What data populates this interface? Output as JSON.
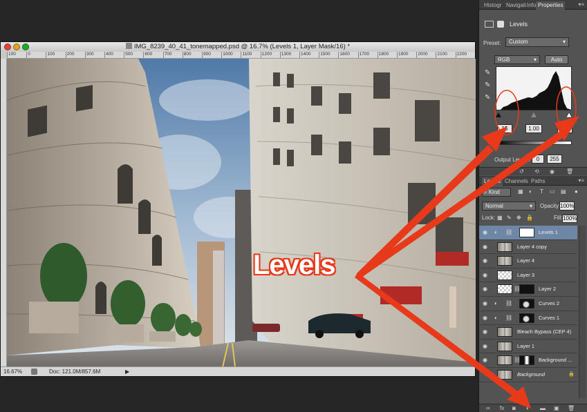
{
  "document": {
    "title": "IMG_8239_40_41_tonemapped.psd @ 16.7% (Levels 1, Layer Mask/16) *",
    "ruler_ticks": [
      "100",
      "0",
      "100",
      "200",
      "300",
      "400",
      "500",
      "600",
      "700",
      "800",
      "900",
      "1000",
      "1100",
      "1200",
      "1300",
      "1400",
      "1500",
      "1600",
      "1700",
      "1800",
      "1900",
      "2000",
      "2100",
      "2200"
    ],
    "status_zoom": "16.67%",
    "status_doc": "Doc: 121.0M/857.6M",
    "status_arrow": "▶"
  },
  "panels": {
    "top_tabs": [
      "Histogr",
      "Navigati",
      "Info",
      "Properties"
    ],
    "active_tab": "Properties",
    "menu": "▾≡"
  },
  "properties": {
    "title": "Levels",
    "preset_label": "Preset:",
    "preset_value": "Custom",
    "channel_value": "RGB",
    "auto_label": "Auto",
    "input_black": "15",
    "input_gamma": "1.00",
    "input_white": "248",
    "output_label": "Output Levels:",
    "output_black": "0",
    "output_white": "255"
  },
  "layers_panel": {
    "tabs": [
      "Layers",
      "Channels",
      "Paths"
    ],
    "active_tab": "Layers",
    "kind_label": "Kind",
    "blend_mode": "Normal",
    "opacity_label": "Opacity:",
    "opacity_value": "100%",
    "lock_label": "Lock:",
    "fill_label": "Fill:",
    "fill_value": "100%",
    "layers": [
      {
        "name": "Levels 1",
        "selected": true,
        "type": "adjustment",
        "mask": "white"
      },
      {
        "name": "Layer 4 copy",
        "selected": false,
        "type": "image"
      },
      {
        "name": "Layer 4",
        "selected": false,
        "type": "image"
      },
      {
        "name": "Layer 3",
        "selected": false,
        "type": "transparent"
      },
      {
        "name": "Layer 2",
        "selected": false,
        "type": "masked",
        "mask": "black"
      },
      {
        "name": "Curves 2",
        "selected": false,
        "type": "adjustment",
        "mask": "dark"
      },
      {
        "name": "Curves 1",
        "selected": false,
        "type": "adjustment",
        "mask": "dark"
      },
      {
        "name": "Bleach Bypass (CEP 4)",
        "selected": false,
        "type": "image"
      },
      {
        "name": "Layer 1",
        "selected": false,
        "type": "image"
      },
      {
        "name": "Background ...",
        "selected": false,
        "type": "masked",
        "mask": "shape"
      },
      {
        "name": "Background",
        "selected": false,
        "type": "background",
        "locked": true
      }
    ]
  },
  "annotation": {
    "callout_text": "Levels",
    "accent_color": "#e83a1b"
  },
  "colors": {
    "panel_bg": "#535353",
    "selection": "#6f87a6",
    "window_chrome": "#d6d6d6"
  },
  "icons": {
    "eye": "eye-icon",
    "lock": "lock-icon",
    "eyedropper": "eyedropper-icon",
    "chain": "chain-link-icon"
  }
}
